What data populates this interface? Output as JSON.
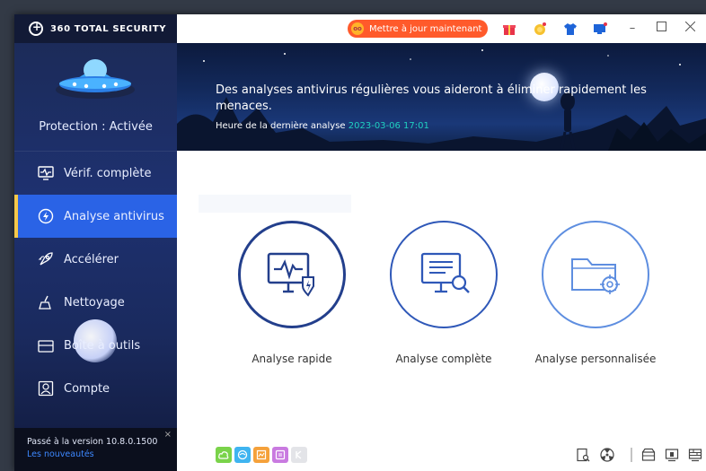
{
  "app": {
    "brand": "360 TOTAL SECURITY"
  },
  "sidebar": {
    "status": "Protection : Activée",
    "items": [
      {
        "label": "Vérif. complète",
        "icon": "monitor-pulse-icon"
      },
      {
        "label": "Analyse antivirus",
        "icon": "shield-scan-icon",
        "active": true
      },
      {
        "label": "Accélérer",
        "icon": "rocket-icon"
      },
      {
        "label": "Nettoyage",
        "icon": "broom-icon"
      },
      {
        "label": "Boîte à outils",
        "icon": "toolbox-icon"
      },
      {
        "label": "Compte",
        "icon": "account-icon"
      }
    ],
    "update": {
      "version": "Passé à la version 10.8.0.1500",
      "news": "Les nouveautés",
      "close": "×"
    }
  },
  "topbar": {
    "update_button": "Mettre à jour maintenant"
  },
  "banner": {
    "message": "Des analyses antivirus régulières vous aideront à éliminer rapidement les menaces.",
    "last_scan_label": "Heure de la dernière analyse",
    "last_scan_value": "2023-03-06 17:01"
  },
  "scans": [
    {
      "label": "Analyse rapide",
      "icon": "quick-scan-icon"
    },
    {
      "label": "Analyse complète",
      "icon": "full-scan-icon"
    },
    {
      "label": "Analyse personnalisée",
      "icon": "custom-scan-icon"
    }
  ],
  "colors": {
    "accent": "#2a63e6",
    "active_marker": "#f5c84a",
    "update_button": "#ff5a2b",
    "scan_time": "#20d0c0"
  }
}
